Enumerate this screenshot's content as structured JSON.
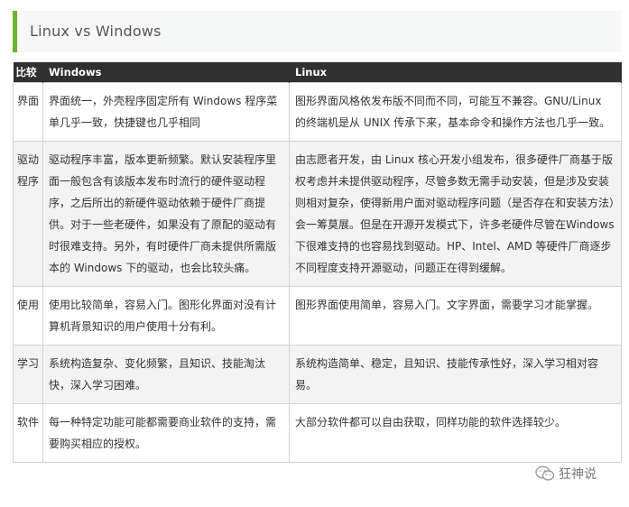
{
  "title": "Linux vs Windows",
  "table": {
    "headers": [
      "比较",
      "Windows",
      "Linux"
    ],
    "rows": [
      {
        "aspect": "界面",
        "windows": "界面统一，外壳程序固定所有 Windows 程序菜单几乎一致，快捷键也几乎相同",
        "linux": "图形界面风格依发布版不同而不同，可能互不兼容。GNU/Linux 的终端机是从 UNIX 传承下来，基本命令和操作方法也几乎一致。"
      },
      {
        "aspect": "驱动程序",
        "windows": "驱动程序丰富，版本更新频繁。默认安装程序里面一般包含有该版本发布时流行的硬件驱动程序，之后所出的新硬件驱动依赖于硬件厂商提供。对于一些老硬件，如果没有了原配的驱动有时很难支持。另外，有时硬件厂商未提供所需版本的 Windows 下的驱动，也会比较头痛。",
        "linux": "由志愿者开发，由 Linux 核心开发小组发布，很多硬件厂商基于版权考虑并未提供驱动程序，尽管多数无需手动安装，但是涉及安装则相对复杂，使得新用户面对驱动程序问题（是否存在和安装方法）会一筹莫展。但是在开源开发模式下，许多老硬件尽管在Windows下很难支持的也容易找到驱动。HP、Intel、AMD 等硬件厂商逐步不同程度支持开源驱动，问题正在得到缓解。"
      },
      {
        "aspect": "使用",
        "windows": "使用比较简单，容易入门。图形化界面对没有计算机背景知识的用户使用十分有利。",
        "linux": "图形界面使用简单，容易入门。文字界面，需要学习才能掌握。"
      },
      {
        "aspect": "学习",
        "windows": "系统构造复杂、变化频繁，且知识、技能淘汰快，深入学习困难。",
        "linux": "系统构造简单、稳定，且知识、技能传承性好，深入学习相对容易。"
      },
      {
        "aspect": "软件",
        "windows": "每一种特定功能可能都需要商业软件的支持，需要购买相应的授权。",
        "linux": "大部分软件都可以自由获取，同样功能的软件选择较少。"
      }
    ]
  },
  "watermark": {
    "text": "狂神说",
    "icon": "wechat-icon"
  },
  "colors": {
    "accent": "#6ab42e",
    "header_bg": "#303030",
    "row_alt_bg": "#f3f3f3",
    "title_bg": "#f6f7f7"
  }
}
